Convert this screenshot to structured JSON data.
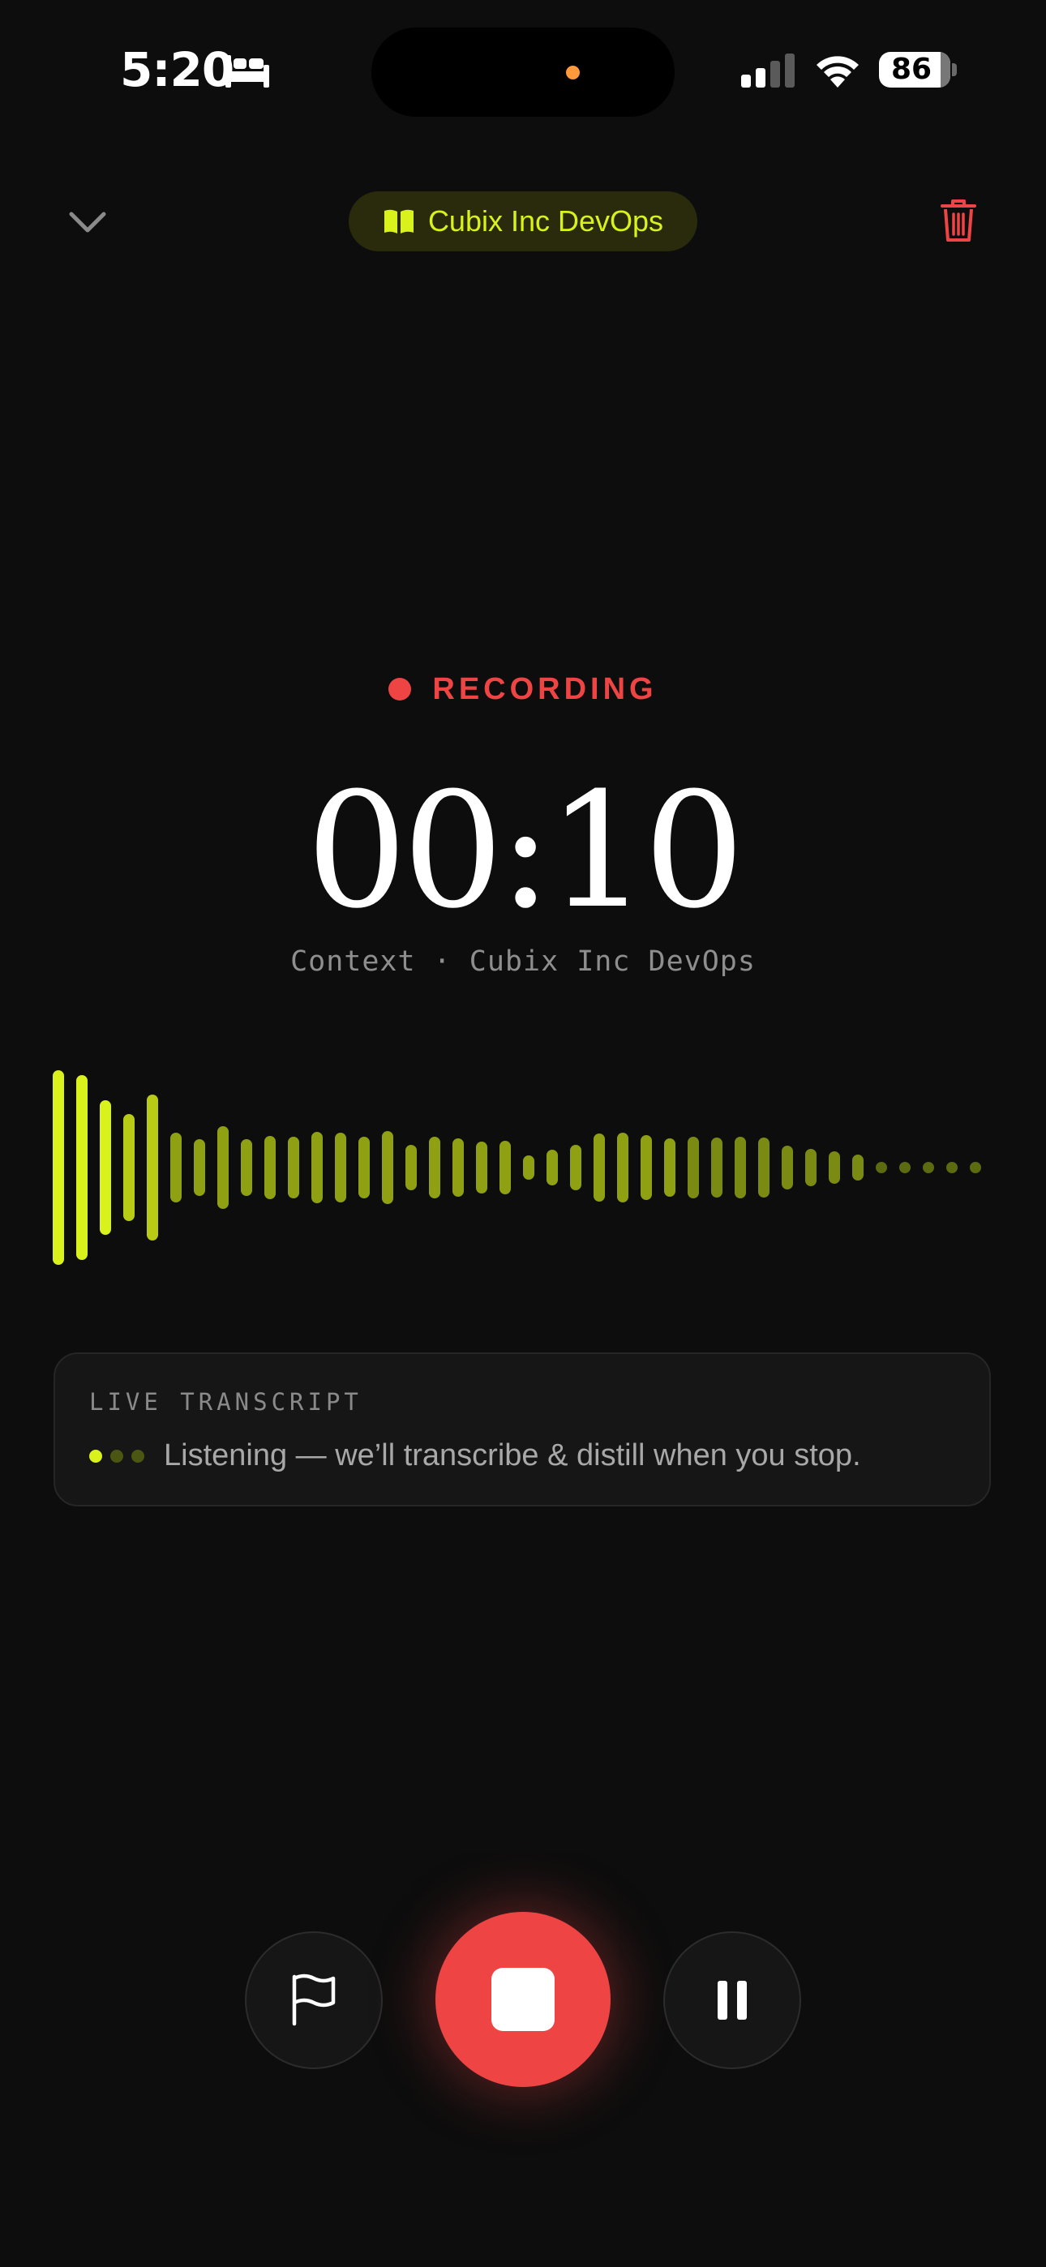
{
  "status_bar": {
    "time": "5:20",
    "battery_level": "86",
    "focus_icon": "bed-icon",
    "signal_icon": "cellular-signal-icon",
    "wifi_icon": "wifi-icon"
  },
  "header": {
    "collapse_icon": "chevron-down-icon",
    "context_pill": {
      "icon": "book-open-icon",
      "label": "Cubix Inc DevOps"
    },
    "delete_icon": "trash-icon"
  },
  "recording": {
    "status_label": "RECORDING",
    "timer": "00:10",
    "context_line": "Context · Cubix Inc DevOps"
  },
  "transcript": {
    "title": "LIVE TRANSCRIPT",
    "text": "Listening — we’ll transcribe & distill when you stop."
  },
  "controls": {
    "flag_icon": "flag-icon",
    "stop_icon": "stop-icon",
    "pause_icon": "pause-icon"
  },
  "colors": {
    "background": "#0d0d0d",
    "accent": "#d9f21c",
    "recording_red": "#ef4444",
    "pill_background": "#2a2b0c",
    "card_background": "#161616",
    "muted_text": "#8e8e8e"
  }
}
